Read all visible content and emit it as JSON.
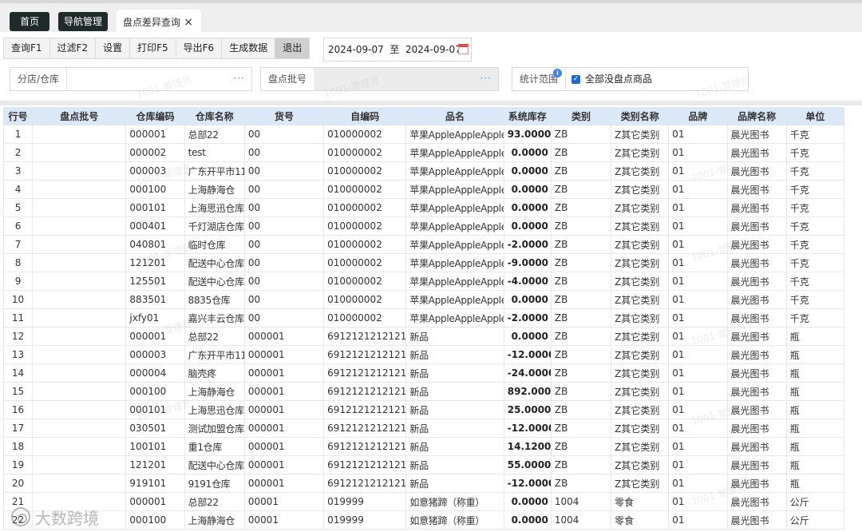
{
  "nav": {
    "home": "首页",
    "manage": "导航管理"
  },
  "tab": {
    "title": "盘点差异查询",
    "close": "×"
  },
  "toolbar": {
    "buttons": [
      "查询F1",
      "过滤F2",
      "设置",
      "打印F5",
      "导出F6",
      "生成数据",
      "退出"
    ]
  },
  "date": {
    "text": "2024-09-07  至  2024-09-07"
  },
  "filters": {
    "store_label": "分店/仓库",
    "batch_label": "盘点批号",
    "range_label": "统计范围",
    "dots": "···",
    "info": "i",
    "check_label": "全部没盘点商品",
    "check_mark": "✓"
  },
  "watermark": "1001-管理员",
  "logo": "大数跨境",
  "table": {
    "columns": [
      "行号",
      "盘点批号",
      "仓库编码",
      "仓库名称",
      "货号",
      "自编码",
      "品名",
      "系统库存",
      "类别",
      "类别名称",
      "品牌",
      "品牌名称",
      "单位"
    ],
    "rows": [
      [
        "1",
        "",
        "000001",
        "总部22",
        "00",
        "010000002",
        "苹果AppleAppleApple",
        "93.0000",
        "ZB",
        "Z其它类别",
        "01",
        "晨光图书",
        "千克"
      ],
      [
        "2",
        "",
        "000002",
        "test",
        "00",
        "010000002",
        "苹果AppleAppleApple",
        "0.0000",
        "ZB",
        "Z其它类别",
        "01",
        "晨光图书",
        "千克"
      ],
      [
        "3",
        "",
        "000003",
        "广东开平市11",
        "00",
        "010000002",
        "苹果AppleAppleApple",
        "0.0000",
        "ZB",
        "Z其它类别",
        "01",
        "晨光图书",
        "千克"
      ],
      [
        "4",
        "",
        "000100",
        "上海静海仓",
        "00",
        "010000002",
        "苹果AppleAppleApple",
        "0.0000",
        "ZB",
        "Z其它类别",
        "01",
        "晨光图书",
        "千克"
      ],
      [
        "5",
        "",
        "000101",
        "上海思迅仓库",
        "00",
        "010000002",
        "苹果AppleAppleApple",
        "0.0000",
        "ZB",
        "Z其它类别",
        "01",
        "晨光图书",
        "千克"
      ],
      [
        "6",
        "",
        "000401",
        "千灯湖店仓库",
        "00",
        "010000002",
        "苹果AppleAppleApple",
        "0.0000",
        "ZB",
        "Z其它类别",
        "01",
        "晨光图书",
        "千克"
      ],
      [
        "7",
        "",
        "040801",
        "临时仓库",
        "00",
        "010000002",
        "苹果AppleAppleApple",
        "-2.0000",
        "ZB",
        "Z其它类别",
        "01",
        "晨光图书",
        "千克"
      ],
      [
        "8",
        "",
        "121201",
        "配送中心仓库",
        "00",
        "010000002",
        "苹果AppleAppleApple",
        "-9.0000",
        "ZB",
        "Z其它类别",
        "01",
        "晨光图书",
        "千克"
      ],
      [
        "9",
        "",
        "125501",
        "配送中心仓库",
        "00",
        "010000002",
        "苹果AppleAppleApple",
        "-4.0000",
        "ZB",
        "Z其它类别",
        "01",
        "晨光图书",
        "千克"
      ],
      [
        "10",
        "",
        "883501",
        "8835仓库",
        "00",
        "010000002",
        "苹果AppleAppleApple",
        "0.0000",
        "ZB",
        "Z其它类别",
        "01",
        "晨光图书",
        "千克"
      ],
      [
        "11",
        "",
        "jxfy01",
        "嘉兴丰云仓库",
        "00",
        "010000002",
        "苹果AppleAppleApple",
        "-2.0000",
        "ZB",
        "Z其它类别",
        "01",
        "晨光图书",
        "千克"
      ],
      [
        "12",
        "",
        "000001",
        "总部22",
        "000001",
        "69121212121212",
        "新品",
        "0.0000",
        "ZB",
        "Z其它类别",
        "01",
        "晨光图书",
        "瓶"
      ],
      [
        "13",
        "",
        "000003",
        "广东开平市11",
        "000001",
        "69121212121212",
        "新品",
        "-12.0000",
        "ZB",
        "Z其它类别",
        "01",
        "晨光图书",
        "瓶"
      ],
      [
        "14",
        "",
        "000004",
        "脑壳疼",
        "000001",
        "69121212121212",
        "新品",
        "-24.0000",
        "ZB",
        "Z其它类别",
        "01",
        "晨光图书",
        "瓶"
      ],
      [
        "15",
        "",
        "000100",
        "上海静海仓",
        "000001",
        "69121212121212",
        "新品",
        "892.0000",
        "ZB",
        "Z其它类别",
        "01",
        "晨光图书",
        "瓶"
      ],
      [
        "16",
        "",
        "000101",
        "上海思迅仓库",
        "000001",
        "69121212121212",
        "新品",
        "25.0000",
        "ZB",
        "Z其它类别",
        "01",
        "晨光图书",
        "瓶"
      ],
      [
        "17",
        "",
        "030501",
        "测试加盟仓库",
        "000001",
        "69121212121212",
        "新品",
        "-12.0000",
        "ZB",
        "Z其它类别",
        "01",
        "晨光图书",
        "瓶"
      ],
      [
        "18",
        "",
        "100101",
        "重1仓库",
        "000001",
        "69121212121212",
        "新品",
        "14.1200",
        "ZB",
        "Z其它类别",
        "01",
        "晨光图书",
        "瓶"
      ],
      [
        "19",
        "",
        "121201",
        "配送中心仓库",
        "000001",
        "69121212121212",
        "新品",
        "55.0000",
        "ZB",
        "Z其它类别",
        "01",
        "晨光图书",
        "瓶"
      ],
      [
        "20",
        "",
        "919101",
        "9191仓库",
        "000001",
        "69121212121212",
        "新品",
        "-12.0000",
        "ZB",
        "Z其它类别",
        "01",
        "晨光图书",
        "瓶"
      ],
      [
        "21",
        "",
        "000001",
        "总部22",
        "00001",
        "019999",
        "如意猪蹄（称重）",
        "0.0000",
        "1004",
        "零食",
        "01",
        "晨光图书",
        "公斤"
      ],
      [
        "22",
        "",
        "000100",
        "上海静海仓",
        "00001",
        "019999",
        "如意猪蹄（称重）",
        "0.0000",
        "1004",
        "零食",
        "01",
        "晨光图书",
        "公斤"
      ]
    ]
  }
}
